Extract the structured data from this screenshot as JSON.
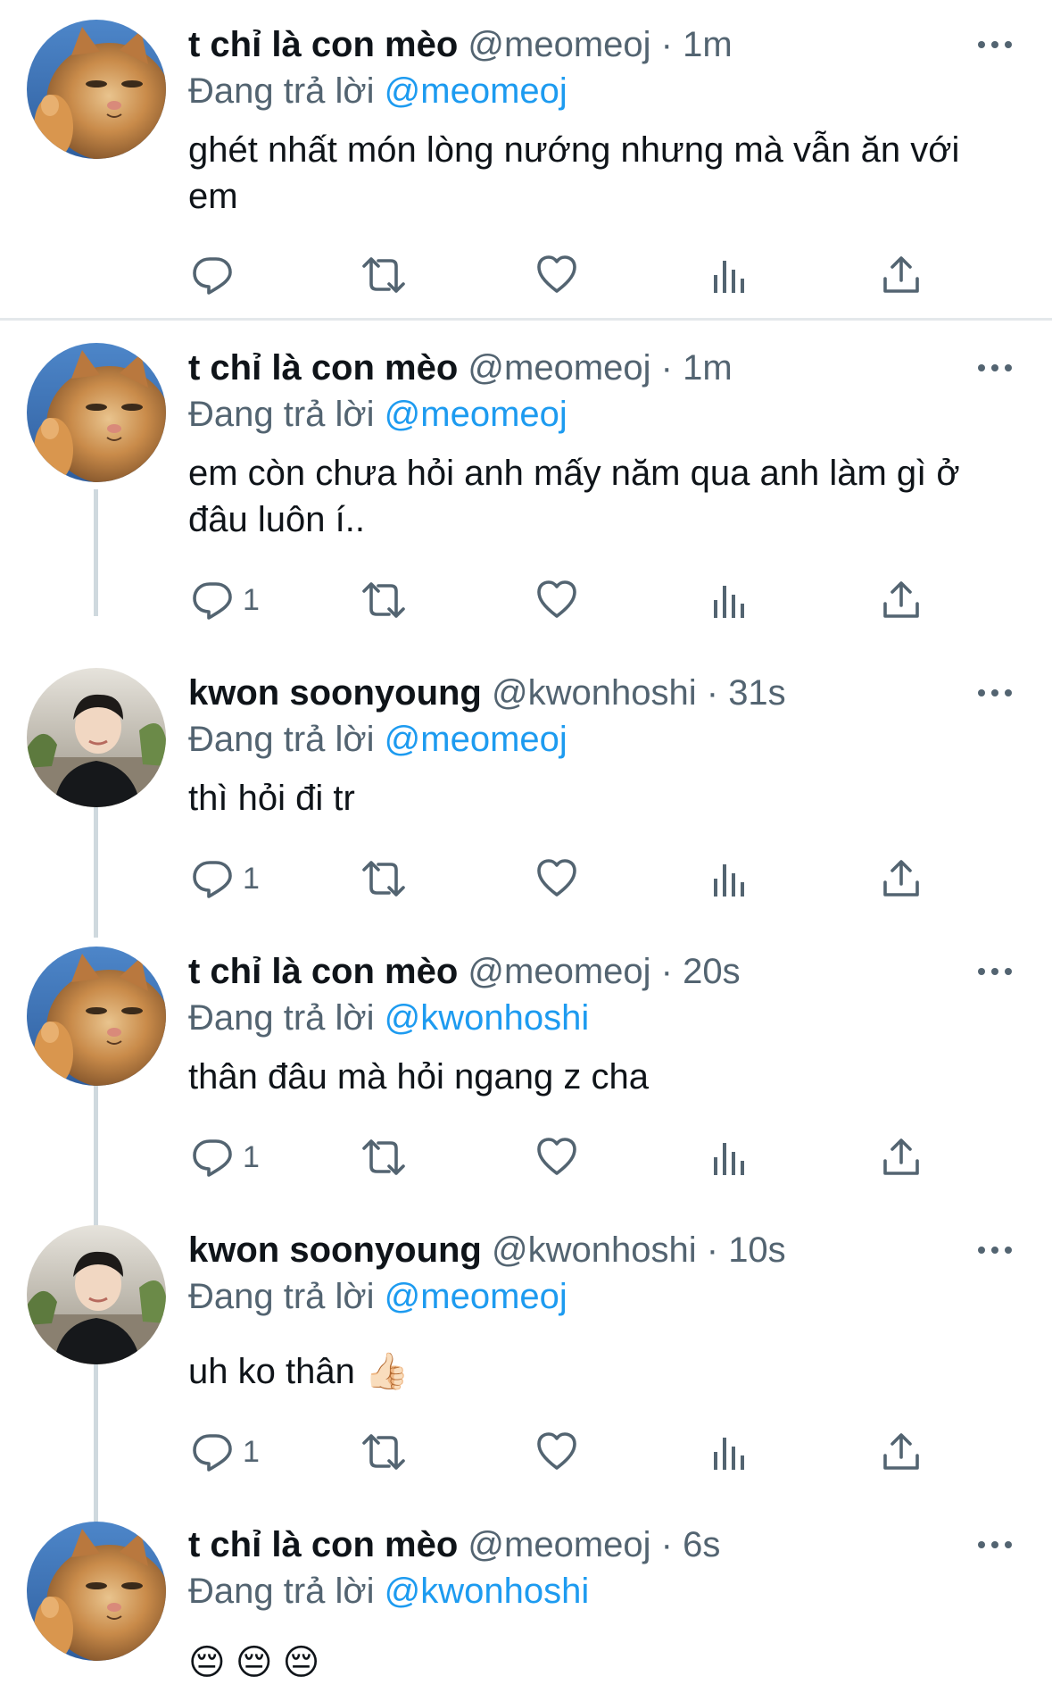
{
  "reply_prefix": "Đang trả lời",
  "colors": {
    "link": "#1d9bf0",
    "muted": "#536471",
    "text": "#0f1419",
    "divider": "#e4e8eb",
    "thread_line": "#cfd9de"
  },
  "tweets": [
    {
      "name": "t chỉ là con mèo",
      "handle": "@meomeoj",
      "time": "1m",
      "mention": "@meomeoj",
      "text": "ghét nhất món lòng nướng nhưng mà vẫn ăn với em",
      "reply_count": "",
      "avatar": "cat-avatar"
    },
    {
      "name": "t chỉ là con mèo",
      "handle": "@meomeoj",
      "time": "1m",
      "mention": "@meomeoj",
      "text": "em còn chưa hỏi anh mấy năm qua anh làm gì ở đâu luôn í..",
      "reply_count": "1",
      "avatar": "cat-avatar"
    },
    {
      "name": "kwon soonyoung",
      "handle": "@kwonhoshi",
      "time": "31s",
      "mention": "@meomeoj",
      "text": "thì hỏi đi tr",
      "reply_count": "1",
      "avatar": "person-avatar"
    },
    {
      "name": "t chỉ là con mèo",
      "handle": "@meomeoj",
      "time": "20s",
      "mention": "@kwonhoshi",
      "text": "thân đâu mà hỏi ngang z cha",
      "reply_count": "1",
      "avatar": "cat-avatar"
    },
    {
      "name": "kwon soonyoung",
      "handle": "@kwonhoshi",
      "time": "10s",
      "mention": "@meomeoj",
      "text": "uh ko thân 👍🏻",
      "reply_count": "1",
      "avatar": "person-avatar"
    },
    {
      "name": "t chỉ là con mèo",
      "handle": "@meomeoj",
      "time": "6s",
      "mention": "@kwonhoshi",
      "text": "😔 😔 😔",
      "reply_count": "",
      "avatar": "cat-avatar"
    }
  ]
}
